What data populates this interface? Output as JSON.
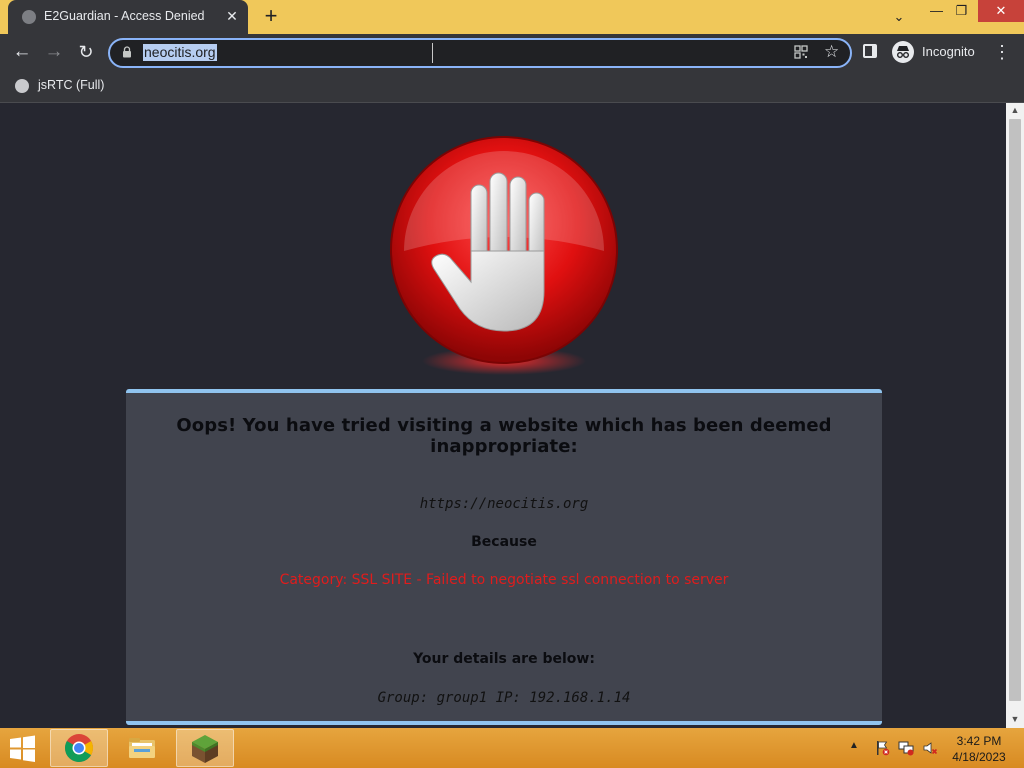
{
  "browser": {
    "tab": {
      "title": "E2Guardian - Access Denied",
      "close_glyph": "✕"
    },
    "new_tab_glyph": "+",
    "window_controls": {
      "tab_search": "⌄",
      "minimize": "—",
      "maximize": "❐",
      "close": "✕"
    },
    "nav": {
      "back": "←",
      "forward": "→",
      "reload": "↻"
    },
    "omnibox": {
      "url": "neocitis.org",
      "star_glyph": "☆"
    },
    "profile": {
      "label": "Incognito"
    },
    "menu_glyph": "⋮",
    "bookmarks": [
      {
        "label": "jsRTC (Full)"
      }
    ]
  },
  "page": {
    "headline": "Oops! You have tried visiting a website which has been deemed inappropriate:",
    "blocked_url": "https://neocitis.org",
    "because_label": "Because",
    "reason": "Category: SSL SITE - Failed to negotiate ssl connection to server",
    "details_heading": "Your details are below:",
    "details_line": "Group: group1   IP: 192.168.1.14"
  },
  "taskbar": {
    "apps": [
      "start-button",
      "chrome",
      "file-explorer",
      "minecraft"
    ],
    "tray_up_glyph": "▲",
    "clock": {
      "time": "3:42 PM",
      "date": "4/18/2023"
    }
  },
  "colors": {
    "titlebar": "#f0c85a",
    "card_border": "#90c4ef",
    "reason_text": "#e01c1c",
    "stop_red": "#e01010"
  },
  "icons": [
    "globe-icon",
    "lock-icon",
    "qr-code-icon",
    "star-icon",
    "side-panel-icon",
    "incognito-icon",
    "menu-icon",
    "stop-hand-icon",
    "windows-logo-icon",
    "chrome-icon",
    "folder-icon",
    "minecraft-icon",
    "flag-icon",
    "network-icon",
    "volume-icon"
  ]
}
